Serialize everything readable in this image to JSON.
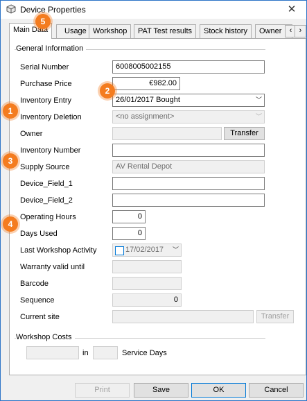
{
  "window": {
    "title": "Device Properties"
  },
  "tabs": [
    {
      "label": "Main Data"
    },
    {
      "label": "Usage"
    },
    {
      "label": "Workshop"
    },
    {
      "label": "PAT Test results"
    },
    {
      "label": "Stock history"
    },
    {
      "label": "Owner"
    }
  ],
  "general": {
    "heading": "General Information",
    "serial_number": {
      "label": "Serial Number",
      "value": "6008005002155"
    },
    "purchase_price": {
      "label": "Purchase Price",
      "value": "€982.00"
    },
    "inventory_entry": {
      "label": "Inventory Entry",
      "value": "26/01/2017 Bought"
    },
    "inventory_deletion": {
      "label": "Inventory Deletion",
      "value": "<no assignment>"
    },
    "owner": {
      "label": "Owner",
      "value": "",
      "button": "Transfer"
    },
    "inventory_number": {
      "label": "Inventory Number",
      "value": ""
    },
    "supply_source": {
      "label": "Supply Source",
      "value": "AV Rental Depot"
    },
    "device_field_1": {
      "label": "Device_Field_1",
      "value": ""
    },
    "device_field_2": {
      "label": "Device_Field_2",
      "value": ""
    },
    "operating_hours": {
      "label": "Operating Hours",
      "value": "0"
    },
    "days_used": {
      "label": "Days Used",
      "value": "0"
    },
    "last_workshop": {
      "label": "Last Workshop Activity",
      "value": "17/02/2017"
    },
    "warranty": {
      "label": "Warranty valid until",
      "value": ""
    },
    "barcode": {
      "label": "Barcode",
      "value": ""
    },
    "sequence": {
      "label": "Sequence",
      "value": "0"
    },
    "current_site": {
      "label": "Current site",
      "value": "",
      "button": "Transfer"
    }
  },
  "workshop_costs": {
    "heading": "Workshop Costs",
    "amount": "",
    "in_label": "in",
    "days": "",
    "service_days_label": "Service Days"
  },
  "buttons": {
    "print": "Print",
    "save": "Save",
    "ok": "OK",
    "cancel": "Cancel"
  },
  "badges": [
    "1",
    "2",
    "3",
    "4",
    "5"
  ],
  "colors": {
    "badge": "#f47c1f",
    "window_border": "#2b73c7"
  }
}
